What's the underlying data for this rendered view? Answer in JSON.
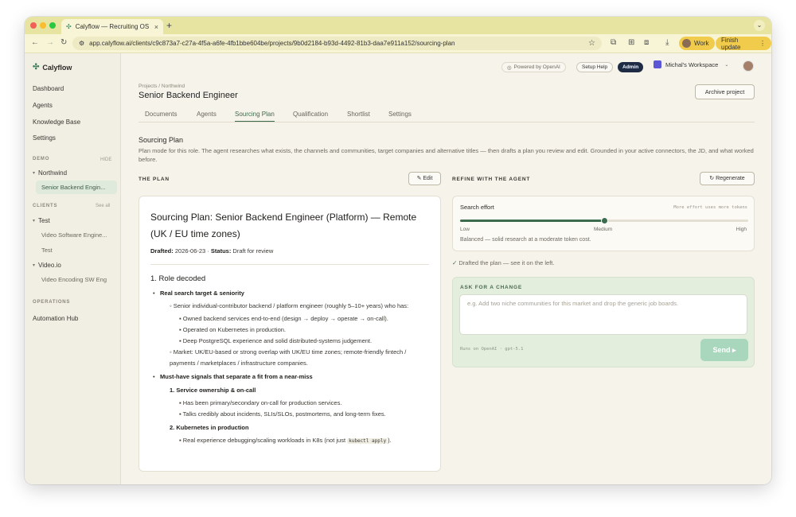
{
  "browser": {
    "tab_title": "Calyflow — Recruiting OS",
    "url": "app.calyflow.ai/clients/c9c873a7-c27a-4f5a-a6fe-4fb1bbe604be/projects/9b0d2184-b93d-4492-81b3-daa7e911a152/sourcing-plan",
    "profile_label": "Work",
    "finish_update_label": "Finish update"
  },
  "sidebar": {
    "brand": "Calyflow",
    "nav": [
      "Dashboard",
      "Agents",
      "Knowledge Base",
      "Settings"
    ],
    "demo_label": "DEMO",
    "demo_action": "HIDE",
    "demo_group": "Northwind",
    "demo_active": "Senior Backend Engin...",
    "clients_label": "CLIENTS",
    "clients_action": "See all",
    "client1": "Test",
    "client1_items": [
      "Video Software Engine...",
      "Test"
    ],
    "client2": "Video.io",
    "client2_items": [
      "Video Encoding SW Eng"
    ],
    "operations_label": "OPERATIONS",
    "operations_items": [
      "Automation Hub"
    ]
  },
  "header": {
    "powered": "Powered by OpenAI",
    "setup_help": "Setup Help",
    "admin": "Admin",
    "workspace": "Michal's Workspace",
    "breadcrumb": "Projects / Northwind",
    "title": "Senior Backend Engineer",
    "archive": "Archive project"
  },
  "tabs": [
    "Documents",
    "Agents",
    "Sourcing Plan",
    "Qualification",
    "Shortlist",
    "Settings"
  ],
  "section": {
    "title": "Sourcing Plan",
    "description": "Plan mode for this role. The agent researches what exists, the channels and communities, target companies and alternative titles — then drafts a plan you review and edit. Grounded in your active connectors, the JD, and what worked before."
  },
  "plan": {
    "heading": "THE PLAN",
    "edit": "✎ Edit",
    "doc_title": "Sourcing Plan: Senior Backend Engineer (Platform) — Remote (UK / EU time zones)",
    "drafted_label": "Drafted:",
    "drafted_value": "2026-06-23 ·",
    "status_label": "Status:",
    "status_value": "Draft for review",
    "h_role": "1. Role decoded",
    "real_target": "Real search target & seniority",
    "target_desc": "Senior individual-contributor backend / platform engineer (roughly 5–10+ years) who has:",
    "target_items": [
      "Owned backend services end-to-end (design → deploy → operate → on-call).",
      "Operated on Kubernetes in production.",
      "Deep PostgreSQL experience and solid distributed-systems judgement."
    ],
    "market": "Market: UK/EU-based or strong overlap with UK/EU time zones; remote-friendly fintech / payments / marketplaces / infrastructure companies.",
    "must_have": "Must-have signals that separate a fit from a near-miss",
    "signal1": "1. Service ownership & on-call",
    "signal1_items": [
      "Has been primary/secondary on-call for production services.",
      "Talks credibly about incidents, SLIs/SLOs, postmortems, and long-term fixes."
    ],
    "signal2": "2. Kubernetes in production",
    "signal2_item_pre": "Real experience debugging/scaling workloads in K8s (not just ",
    "signal2_item_code": "kubectl apply",
    "signal2_item_post": ")."
  },
  "refine": {
    "heading": "REFINE WITH THE AGENT",
    "regenerate": "↻ Regenerate",
    "effort_label": "Search effort",
    "effort_hint": "More effort uses more tokens",
    "effort_level": 0.5,
    "ticks": [
      "Low",
      "Medium",
      "High"
    ],
    "effort_note": "Balanced — solid research at a moderate token cost.",
    "drafted_note": "Drafted the plan — see it on the left.",
    "ask_label": "ASK FOR A CHANGE",
    "ask_placeholder": "e.g. Add two niche communities for this market and drop the generic job boards.",
    "model": "Runs on OpenAI · gpt-5.1",
    "send": "Send ▸"
  }
}
